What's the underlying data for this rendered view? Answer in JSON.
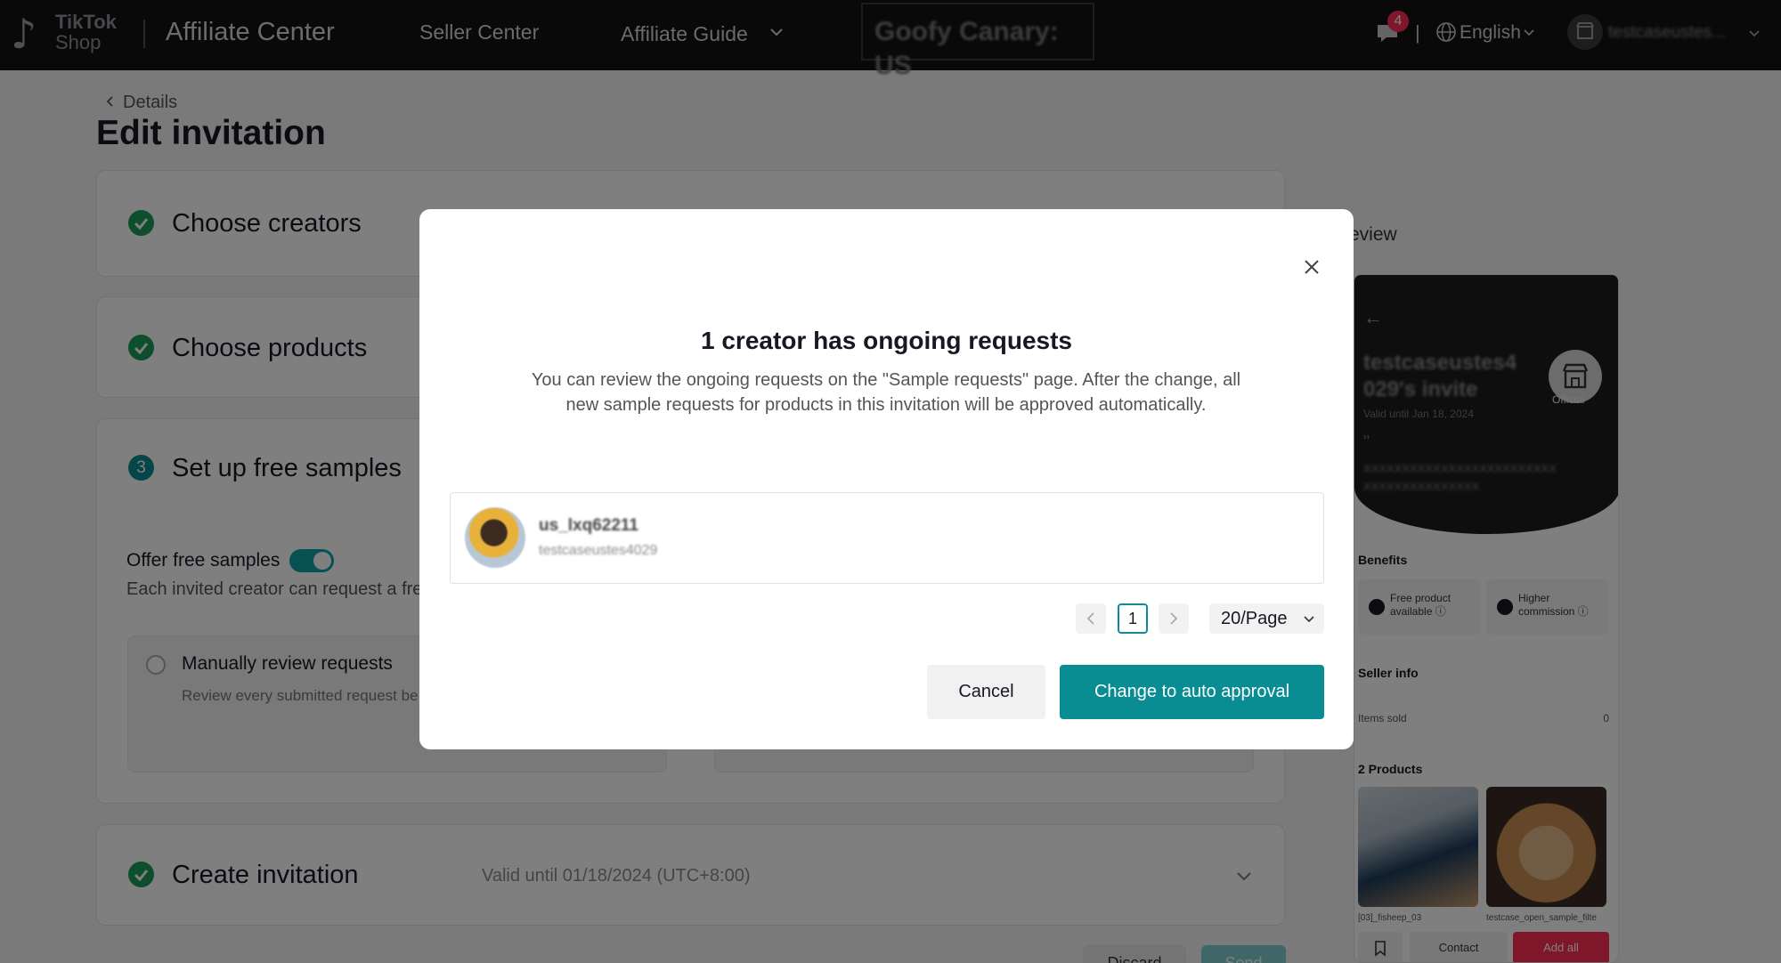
{
  "header": {
    "logo_line1": "TikTok",
    "logo_line2": "Shop",
    "app_title": "Affiliate Center",
    "nav_seller_center": "Seller Center",
    "nav_affiliate_guide": "Affiliate Guide",
    "environment": "Goofy Canary: US",
    "message_badge": "4",
    "separator": "|",
    "language": "English",
    "user_name": "testcaseustes..."
  },
  "page": {
    "back_label": "Details",
    "title": "Edit invitation"
  },
  "steps": {
    "creators": "Choose creators",
    "products": "Choose products",
    "samples_number": "3",
    "samples": "Set up free samples",
    "offer_label": "Offer free samples",
    "offer_enabled": true,
    "offer_desc": "Each invited creator can request a fre",
    "manual_title": "Manually review requests",
    "manual_desc": "Review every submitted request be",
    "create": "Create invitation",
    "create_valid": "Valid until 01/18/2024 (UTC+8:00)",
    "discard": "Discard",
    "save": "Send"
  },
  "preview": {
    "title": "review",
    "arrow": "←",
    "invite_name": "testcaseustes4 029's invite",
    "valid_until": "Valid until Jan 18, 2024",
    "quote": "\"",
    "message": "XXXXXXXXXXXXXXXXXXXXXXXXX XXXXXXXXXXXXXXX",
    "official": "Official",
    "benefits_title": "Benefits",
    "benefit_1": "Free product available ⓘ",
    "benefit_2": "Higher commission ⓘ",
    "seller_info_title": "Seller info",
    "items_sold_label": "Items sold",
    "items_sold_value": "0",
    "products_title": "2 Products",
    "product_1": "[03]_fisheep_03",
    "product_2": "testcase_open_sample_filte",
    "contact": "Contact",
    "add_all": "Add all"
  },
  "modal": {
    "title": "1 creator has ongoing requests",
    "description": "You can review the ongoing requests on the \"Sample requests\" page. After the change, all new sample requests for products in this invitation will be approved automatically.",
    "creator_name": "us_lxq62211",
    "creator_shop": "testcaseustes4029",
    "current_page": "1",
    "page_size": "20/Page",
    "cancel": "Cancel",
    "confirm": "Change to auto approval"
  },
  "colors": {
    "accent_teal": "#0a8c93",
    "success_green": "#1a9c5a",
    "brand_pink": "#fe2c55",
    "topbar": "#121212"
  }
}
